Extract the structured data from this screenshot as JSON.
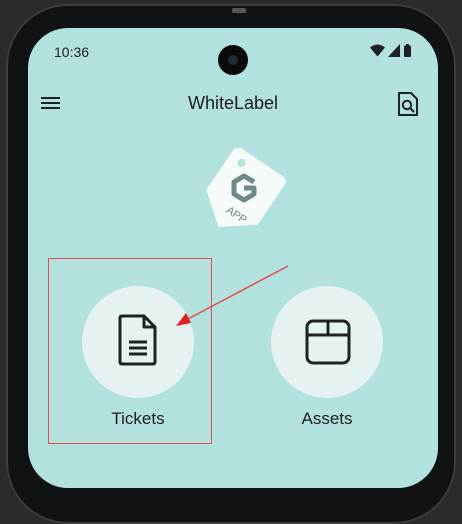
{
  "status_bar": {
    "time": "10:36"
  },
  "app_bar": {
    "title": "WhiteLabel"
  },
  "logo": {
    "letter": "G",
    "text": "APP"
  },
  "tiles": [
    {
      "label": "Tickets",
      "icon": "document-icon"
    },
    {
      "label": "Assets",
      "icon": "box-icon"
    }
  ],
  "colors": {
    "screen_background": "#b3e1dd",
    "tile_circle": "#e6f2f1",
    "annotation": "#e05050"
  }
}
